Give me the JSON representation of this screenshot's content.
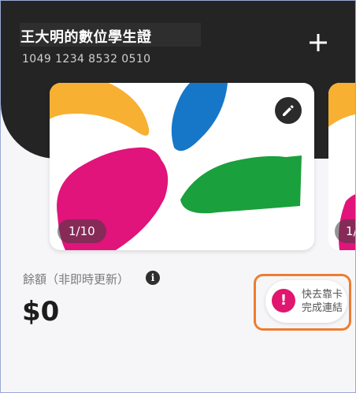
{
  "header": {
    "card_name": "王大明的數位學生證",
    "card_number": "1049 1234 8532 0510",
    "add_icon": "plus-icon"
  },
  "card": {
    "page_indicator": "1/10",
    "edit_icon": "pencil-icon",
    "art_colors": {
      "yellow": "#f7b032",
      "blue": "#1677c8",
      "magenta": "#e0147a",
      "green": "#1aa03c"
    }
  },
  "card_peek": {
    "page_indicator": "1/"
  },
  "balance": {
    "label": "餘額（非即時更新）",
    "info_icon": "info-icon",
    "value": "$0"
  },
  "tap_prompt": {
    "line1": "快去靠卡",
    "line2": "完成連結",
    "alert_icon": "exclamation-icon",
    "highlight_color": "#ed7d31"
  }
}
